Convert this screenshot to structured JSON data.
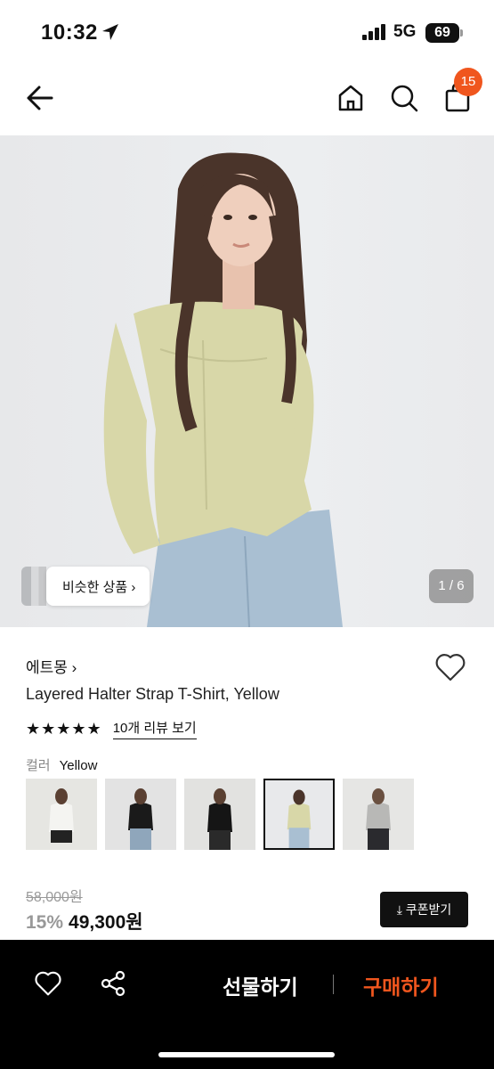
{
  "status_bar": {
    "time": "10:32",
    "network": "5G",
    "battery": "69"
  },
  "nav": {
    "cart_count": "15"
  },
  "gallery": {
    "similar_label": "비슷한 상품 ›",
    "counter": "1 / 6"
  },
  "product": {
    "brand": "에트몽 ›",
    "title": "Layered Halter Strap T-Shirt, Yellow",
    "stars": "★★★★★",
    "review_link": "10개 리뷰 보기",
    "color_label": "컬러",
    "color_value": "Yellow",
    "swatches": [
      {
        "color": "white-black"
      },
      {
        "color": "black-jeans"
      },
      {
        "color": "black"
      },
      {
        "color": "yellow",
        "selected": true
      },
      {
        "color": "grey"
      }
    ],
    "original_price": "58,000원",
    "discount": "15%",
    "price": "49,300원",
    "coupon_label": "⤓ 쿠폰받기"
  },
  "bottom_bar": {
    "gift_label": "선물하기",
    "buy_label": "구매하기"
  },
  "colors": {
    "accent": "#f0561e",
    "top": "#d8d7a8",
    "jeans": "#a9bfd2",
    "hair": "#4a342a"
  }
}
